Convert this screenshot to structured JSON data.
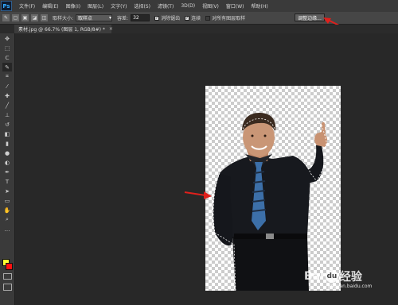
{
  "app": {
    "logo": "Ps"
  },
  "menu": [
    "文件(F)",
    "编辑(E)",
    "图像(I)",
    "图层(L)",
    "文字(Y)",
    "选择(S)",
    "滤镜(T)",
    "3D(D)",
    "视图(V)",
    "窗口(W)",
    "帮助(H)"
  ],
  "options": {
    "sample_size_label": "取样大小:",
    "sample_size_value": "取样点",
    "tolerance_label": "容差:",
    "tolerance_value": "32",
    "antialias_label": "消除锯齿",
    "contiguous_label": "连续",
    "sample_all_label": "对所有图层取样",
    "refine_edge_label": "调整边缘..."
  },
  "document": {
    "tab_title": "素材.jpg @ 66.7% (图层 1, RGB/8#) *",
    "close_glyph": "×"
  },
  "watermark": {
    "brand_a": "Bai",
    "brand_b": "经验",
    "paw": "du",
    "url": "jingyan.baidu.com"
  },
  "colors": {
    "foreground": "#ffff33",
    "background": "#ff1010",
    "arrow": "#e0201c"
  },
  "tools": [
    "move-tool",
    "marquee-tool",
    "lasso-tool",
    "quick-select-tool",
    "crop-tool",
    "eyedropper-tool",
    "healing-brush-tool",
    "brush-tool",
    "clone-stamp-tool",
    "history-brush-tool",
    "eraser-tool",
    "gradient-tool",
    "blur-tool",
    "dodge-tool",
    "pen-tool",
    "type-tool",
    "path-select-tool",
    "shape-tool",
    "hand-tool",
    "zoom-tool"
  ]
}
